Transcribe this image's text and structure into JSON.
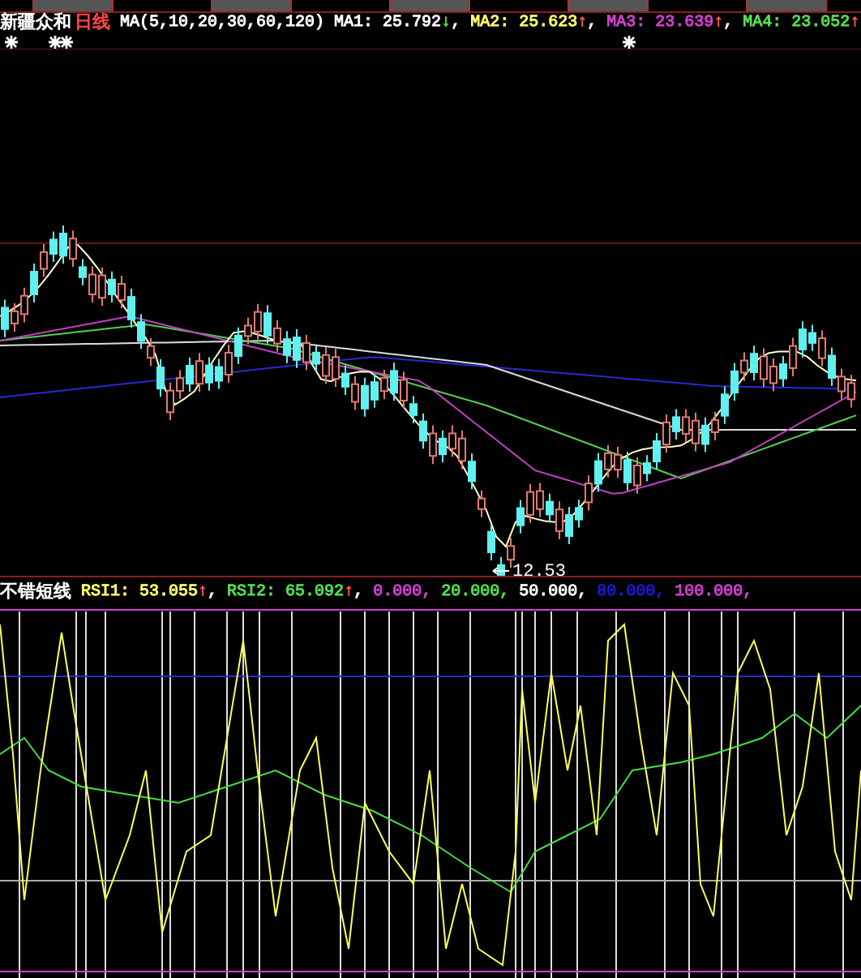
{
  "price_panel": {
    "stock_name": "新疆众和",
    "period": "日线",
    "indicator": "MA(5,10,20,30,60,120)",
    "values": [
      {
        "text": "MA1: 25.792",
        "arrow": {
          "text": "↓",
          "color": "#44dd44"
        },
        "suffix": ",",
        "color": "#ffffff"
      },
      {
        "text": "MA2: 25.623",
        "arrow": {
          "text": "↑",
          "color": "#ff5544"
        },
        "suffix": ",",
        "color": "#ffff66"
      },
      {
        "text": "MA3: 23.639",
        "arrow": {
          "text": "↑",
          "color": "#ff5544"
        },
        "suffix": ",",
        "color": "#d040d0"
      },
      {
        "text": "MA4: 23.052",
        "arrow": {
          "text": "↑",
          "color": "#ff5544"
        },
        "color": "#55dd55"
      }
    ],
    "low_label": "12.53"
  },
  "indicator_panel": {
    "name": "不错短线",
    "values": [
      {
        "text": "RSI1: 53.055",
        "arrow": {
          "text": "↑",
          "color": "#ff5544"
        },
        "suffix": ",",
        "color": "#ffff66"
      },
      {
        "text": "RSI2: 65.092",
        "arrow": {
          "text": "↑",
          "color": "#ff5544"
        },
        "suffix": ",",
        "color": "#55dd55"
      }
    ],
    "levels": [
      {
        "text": "0.000,",
        "color": "#d040d0"
      },
      {
        "text": "20.000,",
        "color": "#55dd55"
      },
      {
        "text": "50.000,",
        "color": "#ffffff"
      },
      {
        "text": "80.000,",
        "color": "#1a1ad0"
      },
      {
        "text": "100.000,",
        "color": "#d040d0"
      }
    ]
  }
}
